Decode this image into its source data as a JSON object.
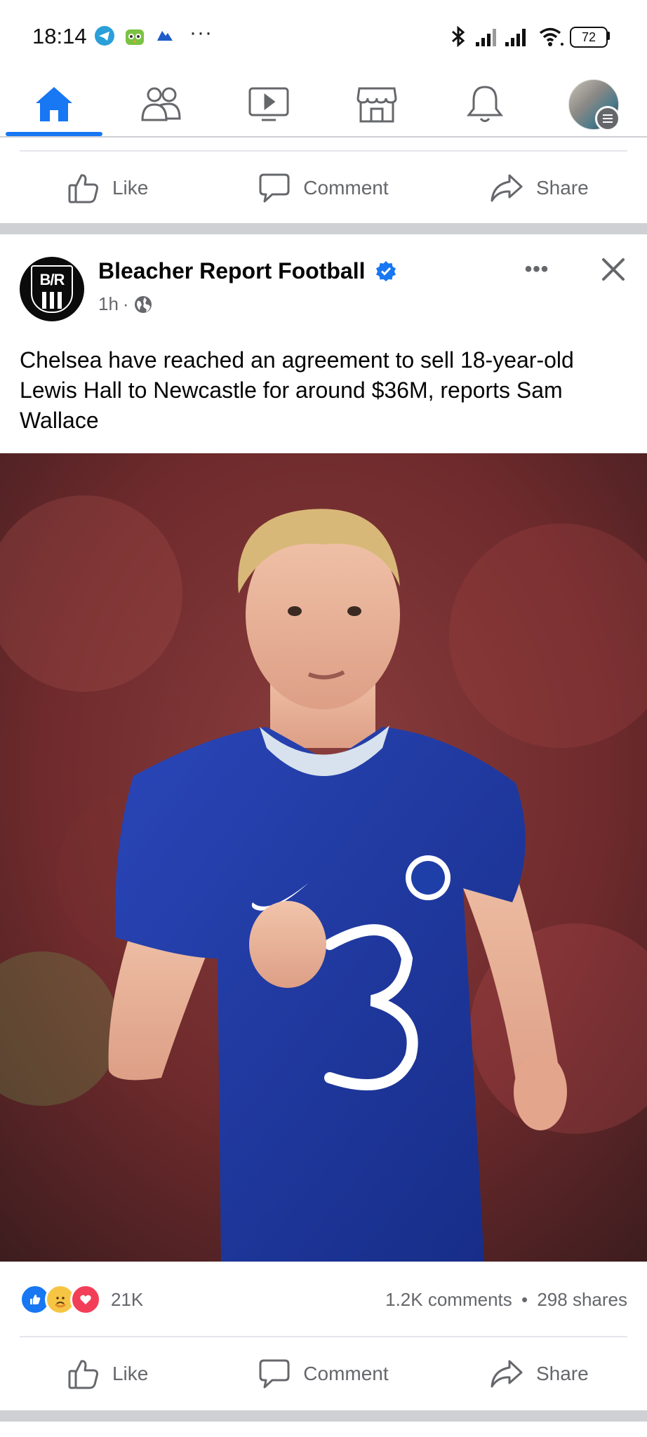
{
  "status_bar": {
    "time": "18:14",
    "battery": "72",
    "icons": [
      "telegram-icon",
      "owl-app-icon",
      "cloud-icon",
      "more-dots-icon",
      "bluetooth-icon",
      "signal-icon",
      "signal-icon",
      "wifi-icon",
      "battery-icon"
    ]
  },
  "nav": {
    "tabs": [
      "home-icon",
      "friends-icon",
      "video-icon",
      "marketplace-icon",
      "notifications-icon",
      "profile-menu-icon"
    ],
    "active": "home",
    "accent": "#1877f2"
  },
  "prev_post_actions": {
    "like": "Like",
    "comment": "Comment",
    "share": "Share"
  },
  "post": {
    "page_name": "Bleacher Report Football",
    "verified": true,
    "time": "1h",
    "audience_icon": "globe-icon",
    "avatar_text": "B/R",
    "caption": "Chelsea have reached an agreement to sell 18-year-old Lewis Hall to Newcastle for around $36M, reports Sam Wallace",
    "image_alt": "Chelsea player in blue kit running on pitch",
    "reactions": [
      "like",
      "care",
      "love"
    ],
    "reaction_count": "21K",
    "comments": "1.2K comments",
    "shares": "298 shares",
    "dot": "•",
    "actions": {
      "like": "Like",
      "comment": "Comment",
      "share": "Share"
    }
  }
}
